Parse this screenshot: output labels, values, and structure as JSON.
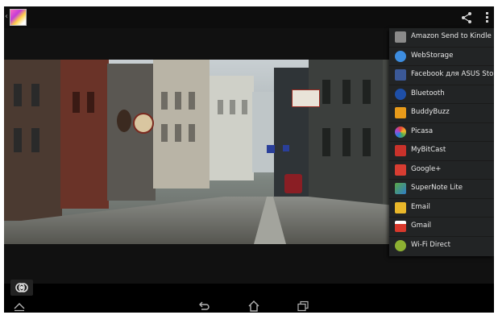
{
  "menu": {
    "items": [
      {
        "label": "Amazon Send to Kindle",
        "icon": "kindle-icon",
        "color": "#8a8a8a"
      },
      {
        "label": "WebStorage",
        "icon": "webstorage-icon",
        "color": "#3d8de0"
      },
      {
        "label": "Facebook для ASUS Story",
        "icon": "facebook-icon",
        "color": "#3b5998"
      },
      {
        "label": "Bluetooth",
        "icon": "bluetooth-icon",
        "color": "#1e4fa8"
      },
      {
        "label": "BuddyBuzz",
        "icon": "buddybuzz-icon",
        "color": "#e79a1a"
      },
      {
        "label": "Picasa",
        "icon": "picasa-icon",
        "color": "#d64bb6"
      },
      {
        "label": "MyBitCast",
        "icon": "mybitcast-icon",
        "color": "#c9322b"
      },
      {
        "label": "Google+",
        "icon": "googleplus-icon",
        "color": "#d73d32"
      },
      {
        "label": "SuperNote Lite",
        "icon": "supernote-icon",
        "color": "#5aa845"
      },
      {
        "label": "Email",
        "icon": "email-icon",
        "color": "#e9b72a"
      },
      {
        "label": "Gmail",
        "icon": "gmail-icon",
        "color": "#d8382c"
      },
      {
        "label": "Wi-Fi Direct",
        "icon": "wifi-direct-icon",
        "color": "#8db032"
      }
    ]
  },
  "colors": {
    "actionbar": "#0d0d0d",
    "menu_bg": "#222425",
    "menu_text": "#e8e8e8"
  }
}
